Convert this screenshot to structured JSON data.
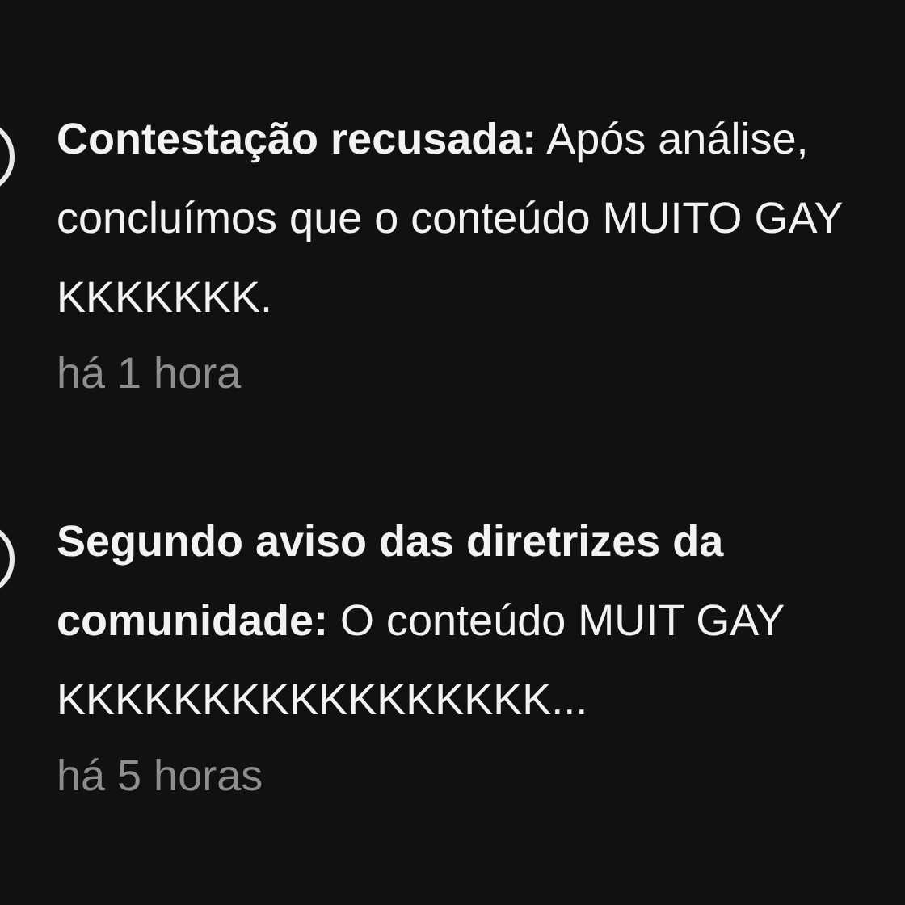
{
  "notifications": [
    {
      "message": "**Contestação recusada:** Após análise, concluímos que o conteúdo MUITO GAY KKKKKKK.",
      "time": "há 1 hora"
    },
    {
      "message": "**Segundo aviso das diretrizes da comunidade:** O conteúdo MUIT GAY KKKKKKKKKKKKKKKKK...",
      "time": "há 5 horas"
    }
  ]
}
